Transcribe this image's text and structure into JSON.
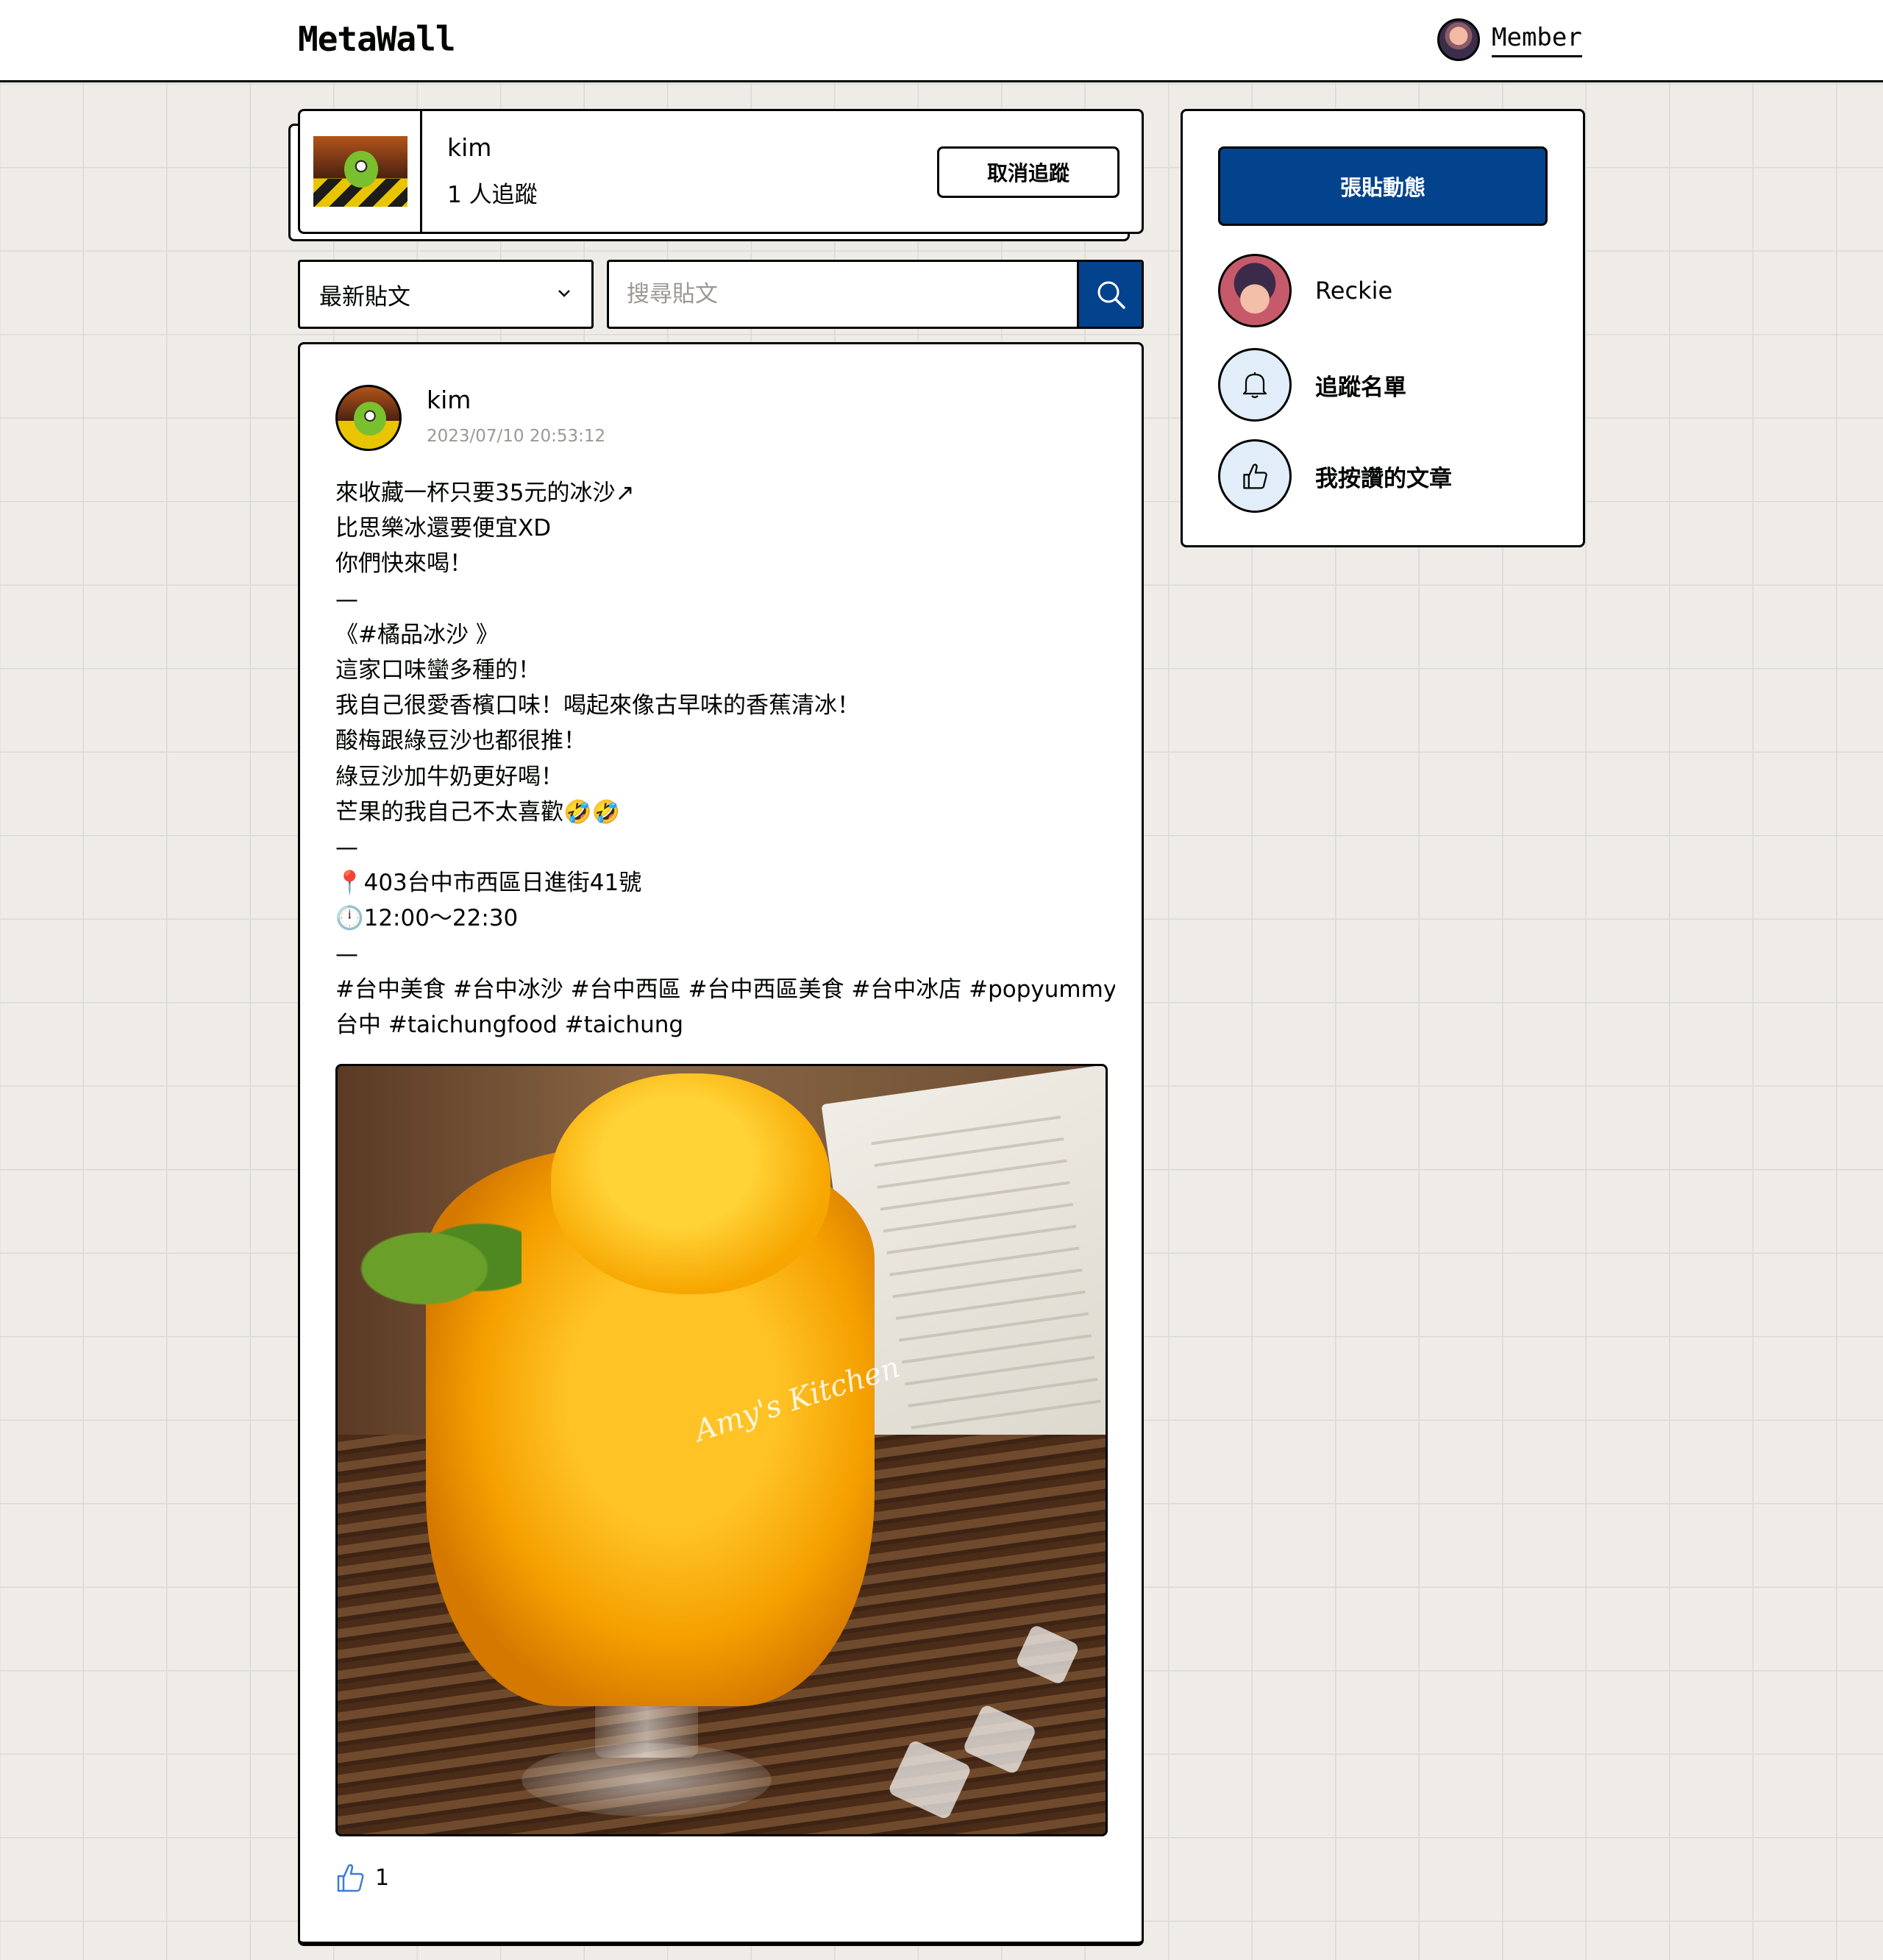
{
  "app": {
    "logo": "MetaWall",
    "member_label": "Member"
  },
  "profile": {
    "name": "kim",
    "followers": "1 人追蹤",
    "unfollow_label": "取消追蹤"
  },
  "filters": {
    "sort_selected": "最新貼文",
    "search_placeholder": "搜尋貼文"
  },
  "post": {
    "author": "kim",
    "timestamp": "2023/07/10 20:53:12",
    "lines": [
      "來收藏一杯只要35元的冰沙↗",
      "比思樂冰還要便宜XD",
      "你們快來喝！",
      "—",
      "《#橘品冰沙 》",
      "這家口味蠻多種的！",
      "我自己很愛香檳口味！喝起來像古早味的香蕉清冰！",
      "酸梅跟綠豆沙也都很推！",
      "綠豆沙加牛奶更好喝！",
      "芒果的我自己不太喜歡🤣🤣",
      "—",
      "📍403台中市西區日進街41號",
      "🕛12:00～22:30",
      "—",
      "#台中美食 #台中冰沙 #台中西區 #台中西區美食 #台中冰店 #popyummy",
      "台中 #taichungfood #taichung"
    ],
    "image_watermark": "Amy's Kitchen",
    "likes": "1"
  },
  "sidebar": {
    "post_button": "張貼動態",
    "user_name": "Reckie",
    "follow_list": "追蹤名單",
    "liked_posts": "我按讚的文章"
  },
  "colors": {
    "primary": "#03438d",
    "background": "#efece7",
    "border": "#000400",
    "muted": "#9b9893"
  },
  "icons": [
    "chevron-down-icon",
    "search-icon",
    "bell-icon",
    "thumbs-up-icon"
  ]
}
